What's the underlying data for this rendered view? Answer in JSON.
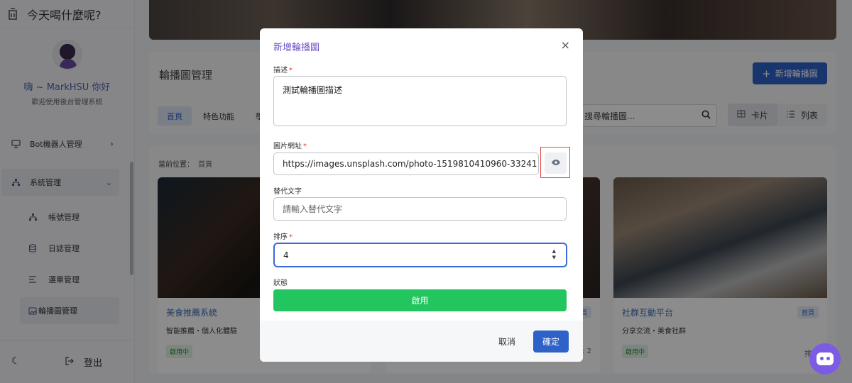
{
  "brand": {
    "title": "今天喝什麼呢?",
    "icon": "cup-icon"
  },
  "profile": {
    "greeting": "嗨 ~ MarkHSU 你好",
    "subtitle": "歡迎使用後台管理系統"
  },
  "sidebar": {
    "items": [
      {
        "label": "Bot機器人管理",
        "icon": "monitor-icon"
      },
      {
        "label": "系統管理",
        "icon": "sitemap-icon"
      },
      {
        "label": "帳號管理",
        "icon": "sitemap-icon"
      },
      {
        "label": "日誌管理",
        "icon": "database-icon"
      },
      {
        "label": "選單管理",
        "icon": "list-icon"
      },
      {
        "label": "輪播圖管理",
        "icon": "image-icon"
      }
    ],
    "logout_label": "登出"
  },
  "panel": {
    "title": "輪播圖管理",
    "add_label": "新增輪播圖",
    "tabs": [
      "首頁",
      "特色功能",
      "學"
    ],
    "search_placeholder": "搜尋輪播圖...",
    "view_card": "卡片",
    "view_list": "列表"
  },
  "breadcrumb": {
    "label": "當前位置：",
    "current": "首頁"
  },
  "cards": [
    {
      "title": "美食推薦系統",
      "desc": "智能推薦・個人化體驗",
      "status": "啟用中",
      "category": "",
      "order": ""
    },
    {
      "title": "",
      "desc": "",
      "status": "",
      "category": "頁",
      "order": ": 2"
    },
    {
      "title": "社群互動平台",
      "desc": "分享交流・美食社群",
      "status": "啟用中",
      "category": "首頁",
      "order": "排序"
    }
  ],
  "modal": {
    "title": "新增輪播圖",
    "close": "×",
    "desc_label": "描述",
    "desc_value": "測試輪播圖描述",
    "url_label": "圖片網址",
    "url_value": "https://images.unsplash.com/photo-1519810410960-33241",
    "alt_label": "替代文字",
    "alt_placeholder": "請輸入替代文字",
    "order_label": "排序",
    "order_value": "4",
    "status_label": "狀態",
    "status_value": "啟用",
    "required_mark": "*",
    "cancel_label": "取消",
    "confirm_label": "確定"
  },
  "colors": {
    "primary": "#2f62c9",
    "success": "#22c55e",
    "accent": "#6f54c4",
    "danger": "#e84545"
  }
}
